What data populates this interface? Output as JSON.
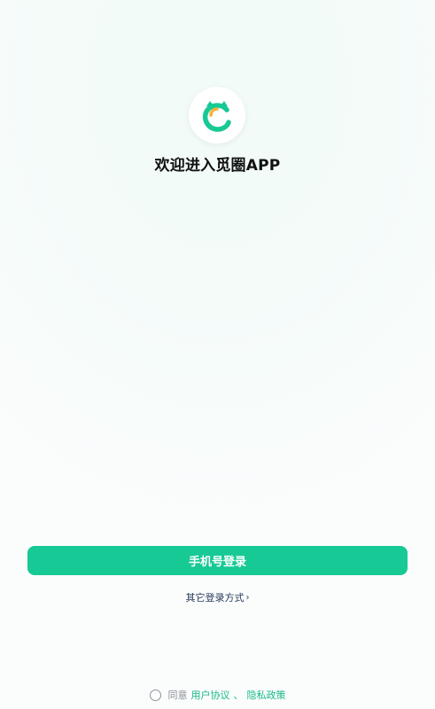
{
  "app": {
    "welcome_title": "欢迎进入觅圈APP"
  },
  "actions": {
    "phone_login": "手机号登录",
    "other_login": "其它登录方式",
    "other_login_chevron": "›"
  },
  "agreement": {
    "prefix": "同意",
    "user_agreement": "用户协议",
    "separator": "、",
    "privacy_policy": "隐私政策"
  },
  "colors": {
    "primary": "#17c995",
    "link": "#17b88a"
  },
  "icons": {
    "logo": "app-logo-icon",
    "radio": "agreement-radio"
  }
}
